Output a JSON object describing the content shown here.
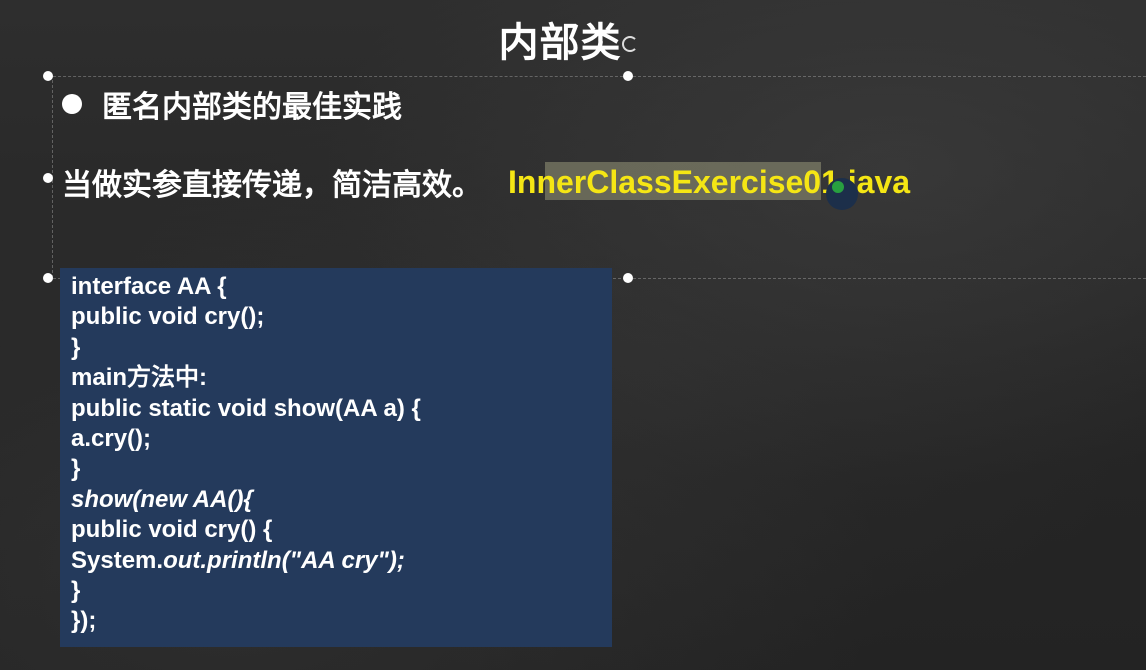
{
  "slide": {
    "title": "内部类",
    "bullet": "匿名内部类的最佳实践",
    "description": "当做实参直接传递，简洁高效。",
    "file_name_part1": "InnerClassExerci",
    "file_name_part2": "se01.java",
    "colors": {
      "background": "#2a2a2a",
      "text": "#ffffff",
      "file_link": "#f5e614",
      "code_box": "#243a5c"
    }
  },
  "code": {
    "line1": "interface AA {",
    "line2": "public void cry();",
    "line3": "}",
    "line4": "main方法中:",
    "line5": "public static void show(AA a) {",
    "line6": "a.cry();",
    "line7": "}",
    "line8": "show(new AA(){",
    "line9": "public void cry() {",
    "line10_prefix": "System.",
    "line10_italic": "out.println(\"AA cry\");",
    "line11": "}",
    "line12": "});"
  }
}
